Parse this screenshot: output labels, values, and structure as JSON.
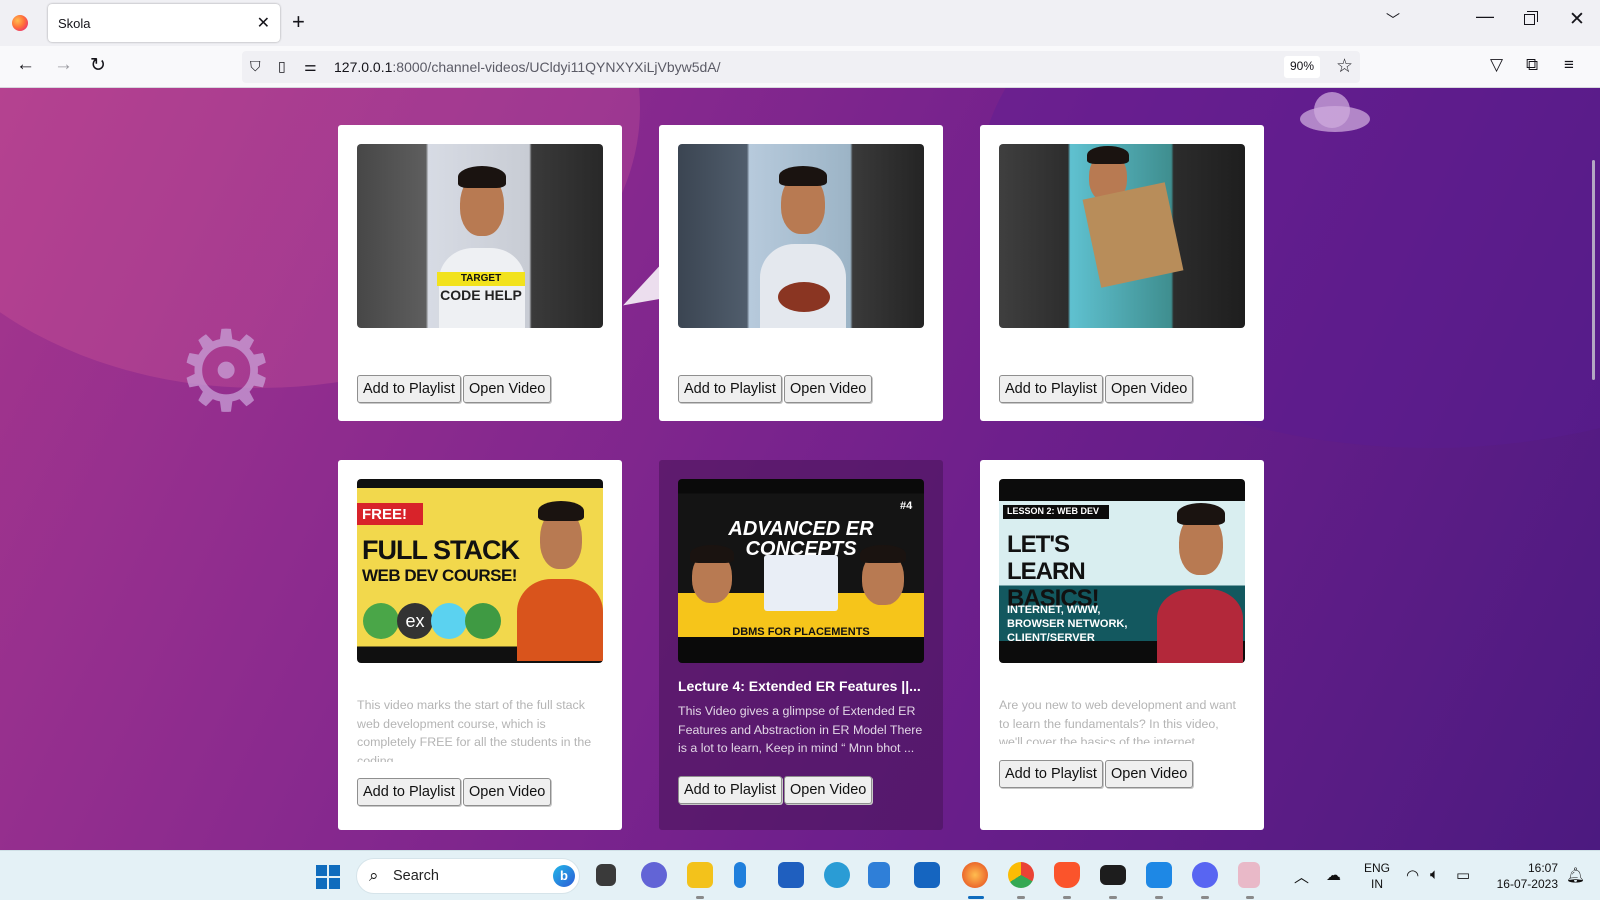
{
  "browser": {
    "tab_title": "Skola",
    "url_host": "127.0.0.1",
    "url_path": ":8000/channel-videos/UCldyi11QYNXYXiLjVbyw5dA/",
    "zoom": "90%"
  },
  "videos": [
    {
      "title": "",
      "description": "",
      "thumbnail": "shorts-target-code-help",
      "overlay": [
        "TARGET",
        "CODE HELP"
      ],
      "add_label": "Add to Playlist",
      "open_label": "Open Video"
    },
    {
      "title": "",
      "description": "",
      "thumbnail": "shorts-cake",
      "overlay": [],
      "add_label": "Add to Playlist",
      "open_label": "Open Video"
    },
    {
      "title": "",
      "description": "",
      "thumbnail": "shorts-unboxing",
      "overlay": [],
      "add_label": "Add to Playlist",
      "open_label": "Open Video"
    },
    {
      "title": "",
      "description": "This video marks the start of the full stack web development course, which is completely FREE for all the students in the coding ...",
      "thumbnail": "full-stack-course",
      "overlay": [
        "FREE!",
        "FULL STACK",
        "WEB DEV COURSE!"
      ],
      "add_label": "Add to Playlist",
      "open_label": "Open Video"
    },
    {
      "title": "Lecture 4: Extended ER Features ||...",
      "description": "This Video gives a glimpse of Extended ER Features and Abstraction in ER Model There is a lot to learn, Keep in mind “ Mnn bhot ...",
      "thumbnail": "advanced-er-concepts",
      "overlay": [
        "ADVANCED ER CONCEPTS",
        "#4",
        "DBMS FOR PLACEMENTS"
      ],
      "add_label": "Add to Playlist",
      "open_label": "Open Video"
    },
    {
      "title": "",
      "description": "Are you new to web development and want to learn the fundamentals? In this video, we'll cover the basics of the internet, ...",
      "thumbnail": "lets-learn-basics",
      "overlay": [
        "LESSON 2: WEB DEV",
        "LET'S LEARN BASICS!",
        "INTERNET, WWW, BROWSER NETWORK, CLIENT/SERVER"
      ],
      "add_label": "Add to Playlist",
      "open_label": "Open Video"
    }
  ],
  "taskbar": {
    "search_placeholder": "Search",
    "language": "ENG",
    "region": "IN",
    "time": "16:07",
    "date": "16-07-2023"
  },
  "colors": {
    "page_gradient_start": "#a5368d",
    "page_gradient_end": "#4c1a80",
    "card_bg": "#ffffff",
    "accent_yellow": "#f6c51a"
  }
}
